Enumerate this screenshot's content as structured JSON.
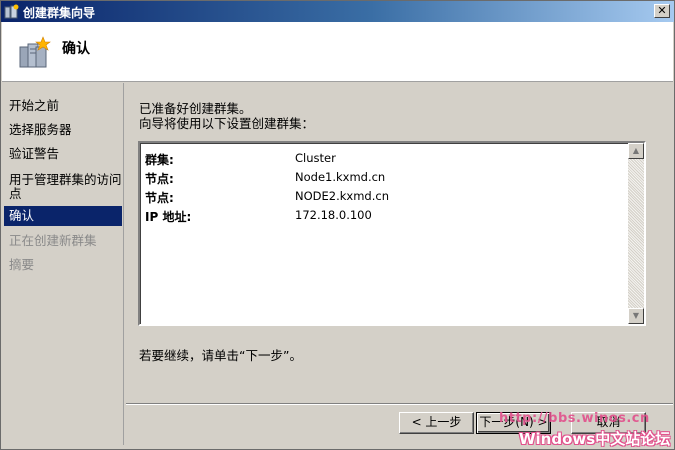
{
  "window": {
    "title": "创建群集向导"
  },
  "header": {
    "heading": "确认"
  },
  "sidebar": {
    "items": [
      {
        "label": "开始之前",
        "state": "normal"
      },
      {
        "label": "选择服务器",
        "state": "normal"
      },
      {
        "label": "验证警告",
        "state": "normal"
      },
      {
        "label": "用于管理群集的访问",
        "label2": "点",
        "state": "normal"
      },
      {
        "label": "确认",
        "state": "active"
      },
      {
        "label": "正在创建新群集",
        "state": "disabled"
      },
      {
        "label": "摘要",
        "state": "disabled"
      }
    ]
  },
  "content": {
    "intro_line1": "已准备好创建群集。",
    "intro_line2": "向导将使用以下设置创建群集：",
    "settings": [
      {
        "key": "群集:",
        "value": "Cluster"
      },
      {
        "key": "节点:",
        "value": "Node1.kxmd.cn"
      },
      {
        "key": "节点:",
        "value": "NODE2.kxmd.cn"
      },
      {
        "key": "IP 地址:",
        "value": "172.18.0.100"
      }
    ],
    "continue_text": "若要继续，请单击“下一步”。"
  },
  "buttons": {
    "back": "< 上一步",
    "next": "下一步(N) >",
    "cancel": "取消"
  },
  "watermark": {
    "line1": "http://bbs.winos.cn",
    "line2": "Windows中文站论坛"
  },
  "colors": {
    "active_item": "#0a246a",
    "titlebar": "#0a246a",
    "watermark": "#e2508c"
  }
}
